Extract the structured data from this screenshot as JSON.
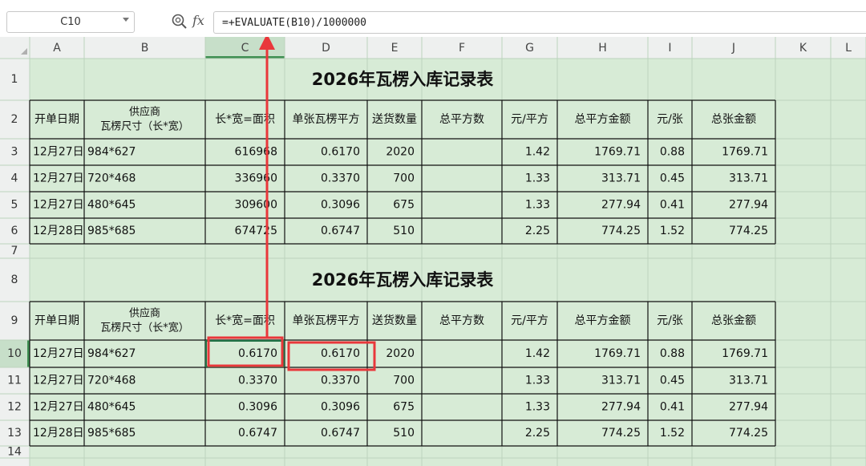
{
  "namebox": "C10",
  "fx_label": "fx",
  "formula": "=+EVALUATE(B10)/1000000",
  "columns": [
    "A",
    "B",
    "C",
    "D",
    "E",
    "F",
    "G",
    "H",
    "I",
    "J",
    "K",
    "L"
  ],
  "row_numbers": [
    "1",
    "2",
    "3",
    "4",
    "5",
    "6",
    "7",
    "8",
    "9",
    "10",
    "11",
    "12",
    "13",
    "14"
  ],
  "tables": [
    {
      "title": "2026年瓦楞入库记录表",
      "headers": [
        "开单日期",
        "供应商\n瓦楞尺寸（长*宽）",
        "长*宽=面积",
        "单张瓦楞平方",
        "送货数量",
        "总平方数",
        "元/平方",
        "总平方金额",
        "元/张",
        "总张金额"
      ],
      "rows": [
        [
          "12月27日",
          "984*627",
          "616968",
          "0.6170",
          "2020",
          "",
          "1.42",
          "1769.71",
          "0.88",
          "1769.71"
        ],
        [
          "12月27日",
          "720*468",
          "336960",
          "0.3370",
          "700",
          "",
          "1.33",
          "313.71",
          "0.45",
          "313.71"
        ],
        [
          "12月27日",
          "480*645",
          "309600",
          "0.3096",
          "675",
          "",
          "1.33",
          "277.94",
          "0.41",
          "277.94"
        ],
        [
          "12月28日",
          "985*685",
          "674725",
          "0.6747",
          "510",
          "",
          "2.25",
          "774.25",
          "1.52",
          "774.25"
        ]
      ]
    },
    {
      "title": "2026年瓦楞入库记录表",
      "headers": [
        "开单日期",
        "供应商\n瓦楞尺寸（长*宽）",
        "长*宽=面积",
        "单张瓦楞平方",
        "送货数量",
        "总平方数",
        "元/平方",
        "总平方金额",
        "元/张",
        "总张金额"
      ],
      "rows": [
        [
          "12月27日",
          "984*627",
          "0.6170",
          "0.6170",
          "2020",
          "",
          "1.42",
          "1769.71",
          "0.88",
          "1769.71"
        ],
        [
          "12月27日",
          "720*468",
          "0.3370",
          "0.3370",
          "700",
          "",
          "1.33",
          "313.71",
          "0.45",
          "313.71"
        ],
        [
          "12月27日",
          "480*645",
          "0.3096",
          "0.3096",
          "675",
          "",
          "1.33",
          "277.94",
          "0.41",
          "277.94"
        ],
        [
          "12月28日",
          "985*685",
          "0.6747",
          "0.6747",
          "510",
          "",
          "2.25",
          "774.25",
          "1.52",
          "774.25"
        ]
      ]
    }
  ],
  "colors": {
    "cell_fill": "#d7ebd6",
    "header_fill": "#eef0ef",
    "selected_header": "#c7dfc9",
    "grid_line": "#bcd3bd",
    "border": "#111111",
    "annotation": "#e9373b"
  },
  "icons": [
    "search-zoom-icon",
    "dropdown-chevron-icon",
    "fx-icon",
    "red-arrow-annotation"
  ]
}
